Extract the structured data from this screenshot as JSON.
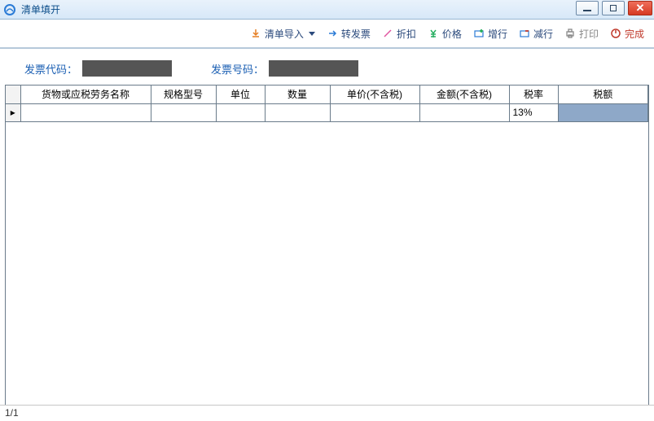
{
  "window": {
    "title": "清单填开"
  },
  "toolbar": {
    "import": "清单导入",
    "convert": "转发票",
    "discount": "折扣",
    "price": "价格",
    "addrow": "增行",
    "delrow": "减行",
    "print": "打印",
    "finish": "完成"
  },
  "codes": {
    "code_label": "发票代码：",
    "number_label": "发票号码："
  },
  "table": {
    "headers": [
      "货物或应税劳务名称",
      "规格型号",
      "单位",
      "数量",
      "单价(不含税)",
      "金额(不含税)",
      "税率",
      "税额"
    ],
    "rows": [
      {
        "name": "",
        "spec": "",
        "unit": "",
        "qty": "",
        "price": "",
        "amount": "",
        "rate": "13%",
        "tax": ""
      }
    ]
  },
  "statusbar": {
    "page": "1/1"
  }
}
